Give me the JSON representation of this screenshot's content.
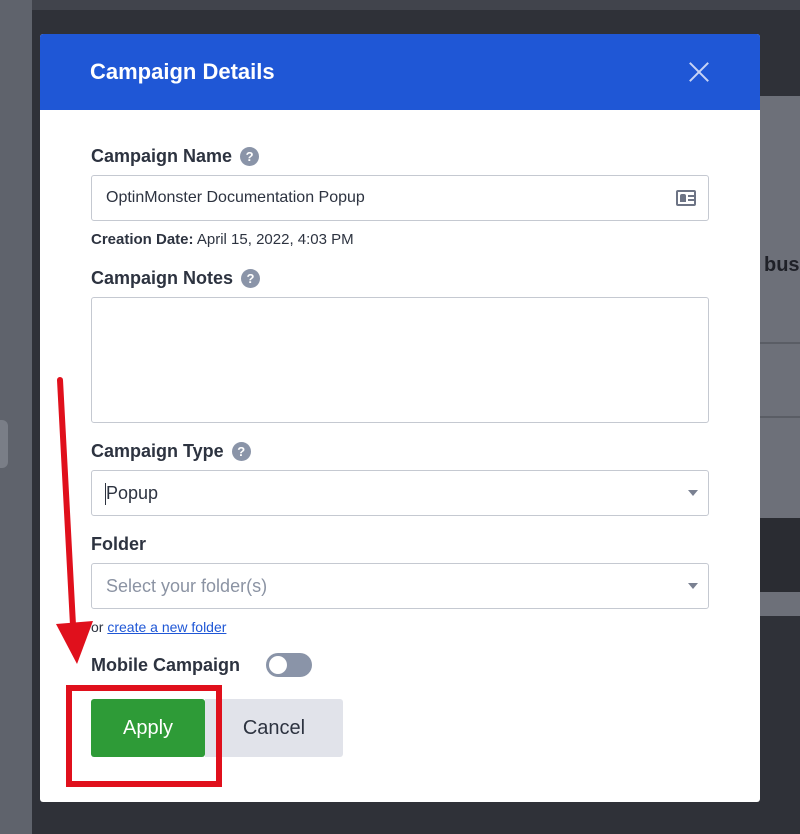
{
  "background": {
    "partial_text": "bus"
  },
  "modal": {
    "title": "Campaign Details",
    "close_icon": "close-icon"
  },
  "campaign_name": {
    "label": "Campaign Name",
    "help_icon_glyph": "?",
    "value": "OptinMonster Documentation Popup",
    "trailing_icon": "contact-card-icon"
  },
  "creation_date": {
    "label": "Creation Date:",
    "value": "April 15, 2022, 4:03 PM"
  },
  "campaign_notes": {
    "label": "Campaign Notes",
    "help_icon_glyph": "?",
    "value": ""
  },
  "campaign_type": {
    "label": "Campaign Type",
    "help_icon_glyph": "?",
    "value": "Popup"
  },
  "folder": {
    "label": "Folder",
    "placeholder": "Select your folder(s)",
    "or_text": "or",
    "create_link": "create a new folder"
  },
  "mobile": {
    "label": "Mobile Campaign",
    "enabled": false
  },
  "buttons": {
    "apply": "Apply",
    "cancel": "Cancel"
  },
  "colors": {
    "header": "#1f57d6",
    "apply": "#2e9b37",
    "annotation": "#e0101c"
  }
}
